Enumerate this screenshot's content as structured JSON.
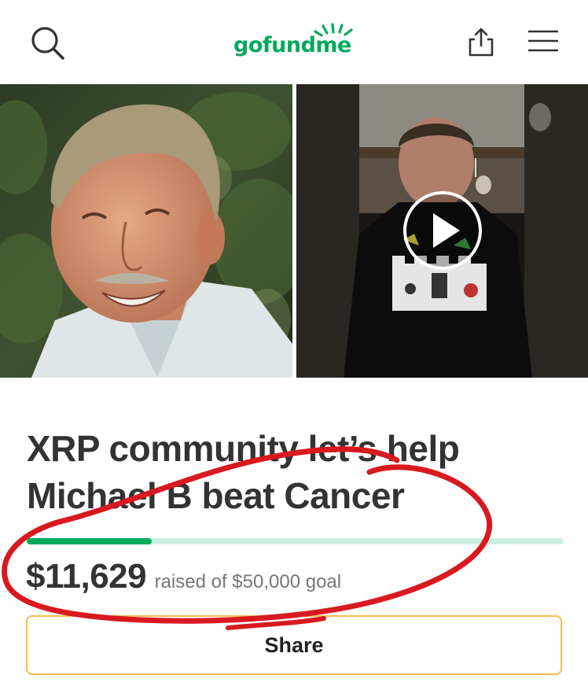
{
  "header": {
    "logo_text": "gofundme",
    "icons": {
      "search": "search-icon",
      "share": "share-upload-icon",
      "menu": "hamburger-menu-icon"
    }
  },
  "media": {
    "left_photo": "photo-of-smiling-man-outdoors",
    "right_video": "video-thumbnail",
    "play_icon": "play-icon"
  },
  "campaign": {
    "title_line1": "XRP community let’s help",
    "title_line2": "Michael B beat Cancer",
    "amount_raised": "$11,629",
    "raised_label": "raised of $50,000 goal",
    "raised_value": 11629,
    "goal_value": 50000,
    "progress_fraction": 0.2326
  },
  "actions": {
    "share_label": "Share"
  },
  "colors": {
    "brand_green": "#02a95c",
    "progress_track": "#cdeee0",
    "share_border": "#f5bd4f",
    "annotation_red": "#d8191f",
    "title_text": "#333333"
  }
}
